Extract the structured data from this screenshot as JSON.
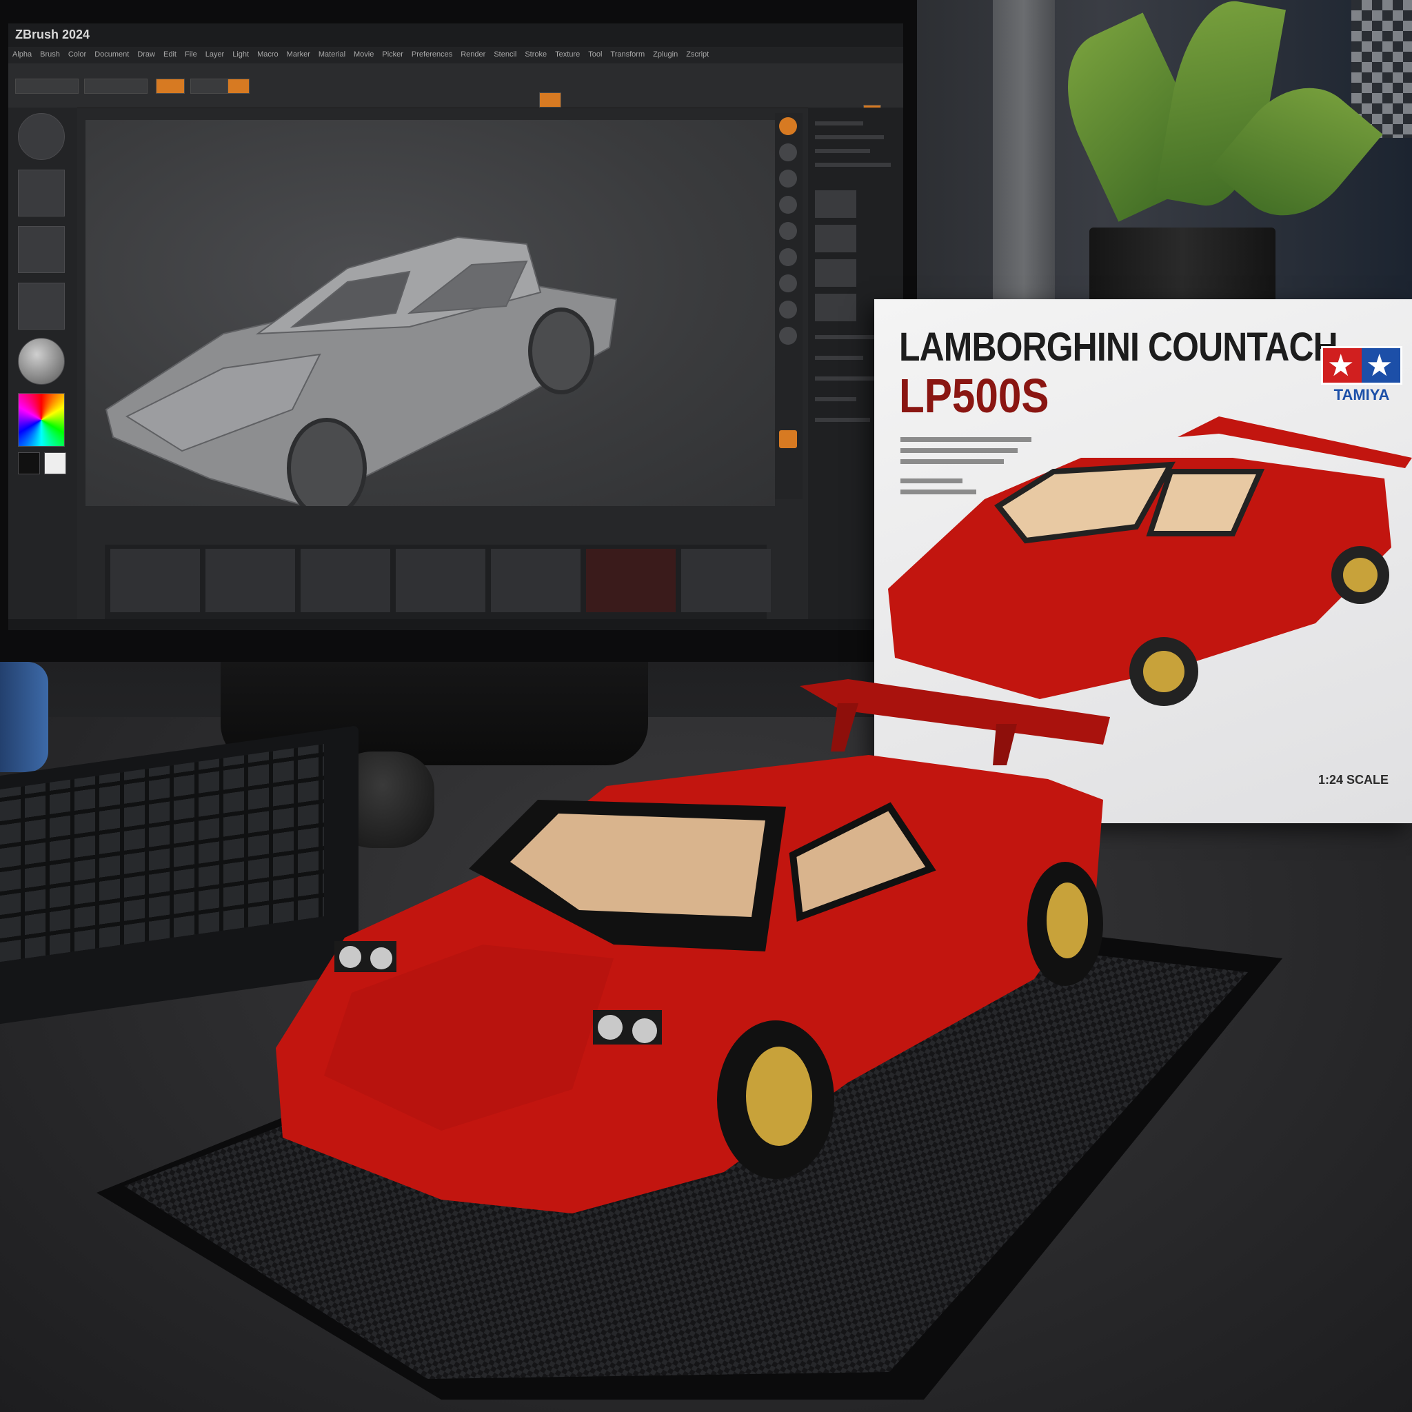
{
  "screen": {
    "app_title": "ZBrush 2024",
    "menu_items": [
      "Alpha",
      "Brush",
      "Color",
      "Document",
      "Draw",
      "Edit",
      "File",
      "Layer",
      "Light",
      "Macro",
      "Marker",
      "Material",
      "Movie",
      "Picker",
      "Preferences",
      "Render",
      "Stencil",
      "Stroke",
      "Texture",
      "Tool",
      "Transform",
      "Zplugin",
      "Zscript"
    ]
  },
  "box": {
    "title": "LAMBORGHINI COUNTACH",
    "model": "LP500S",
    "brand": "TAMIYA",
    "scale_label": "1:24 SCALE"
  },
  "colors": {
    "car_red": "#c2150f",
    "gold_wheel": "#c8a23a",
    "tamiya_red": "#d11f1f",
    "tamiya_blue": "#1c4fa8",
    "zbrush_accent": "#d77a22"
  }
}
